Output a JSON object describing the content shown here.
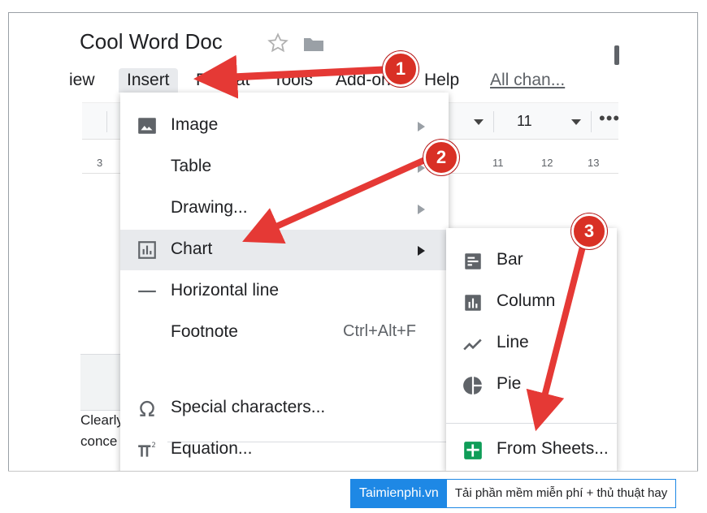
{
  "document": {
    "title": "Cool Word Doc",
    "body_lines": [
      "Clearly",
      "conce"
    ]
  },
  "menubar": {
    "items": [
      "iew",
      "Insert",
      "Format",
      "Tools",
      "Add-ons",
      "Help"
    ],
    "last_edit": "All chan..."
  },
  "toolbar": {
    "font_size": "11",
    "more": "•••"
  },
  "ruler": {
    "marks": [
      "3",
      "11",
      "12",
      "13"
    ]
  },
  "insert_menu": {
    "items": [
      {
        "label": "Image",
        "icon": "image-icon",
        "submenu": true
      },
      {
        "label": "Table",
        "submenu": true
      },
      {
        "label": "Drawing...",
        "submenu": true
      },
      {
        "label": "Chart",
        "icon": "chart-icon",
        "submenu": true,
        "highlighted": true
      },
      {
        "label": "Horizontal line",
        "icon": "horizontal-line-icon"
      },
      {
        "label": "Footnote",
        "shortcut": "Ctrl+Alt+F"
      },
      {
        "label": "Special characters...",
        "icon": "omega-icon"
      },
      {
        "label": "Equation...",
        "icon": "pi-icon"
      }
    ]
  },
  "chart_submenu": {
    "items": [
      {
        "label": "Bar",
        "icon": "bar-chart-icon"
      },
      {
        "label": "Column",
        "icon": "column-chart-icon"
      },
      {
        "label": "Line",
        "icon": "line-chart-icon"
      },
      {
        "label": "Pie",
        "icon": "pie-chart-icon"
      },
      {
        "label": "From Sheets...",
        "icon": "sheets-icon"
      }
    ]
  },
  "annotations": {
    "steps": [
      "1",
      "2",
      "3"
    ],
    "color": "#e53935"
  },
  "watermark": {
    "brand": "Taimienphi.vn",
    "slogan": "Tải phần mềm miễn phí + thủ thuật hay"
  },
  "colors": {
    "menu_hover": "#e8eaed",
    "sheets_green": "#0f9d58",
    "watermark_blue": "#1e88e5"
  }
}
